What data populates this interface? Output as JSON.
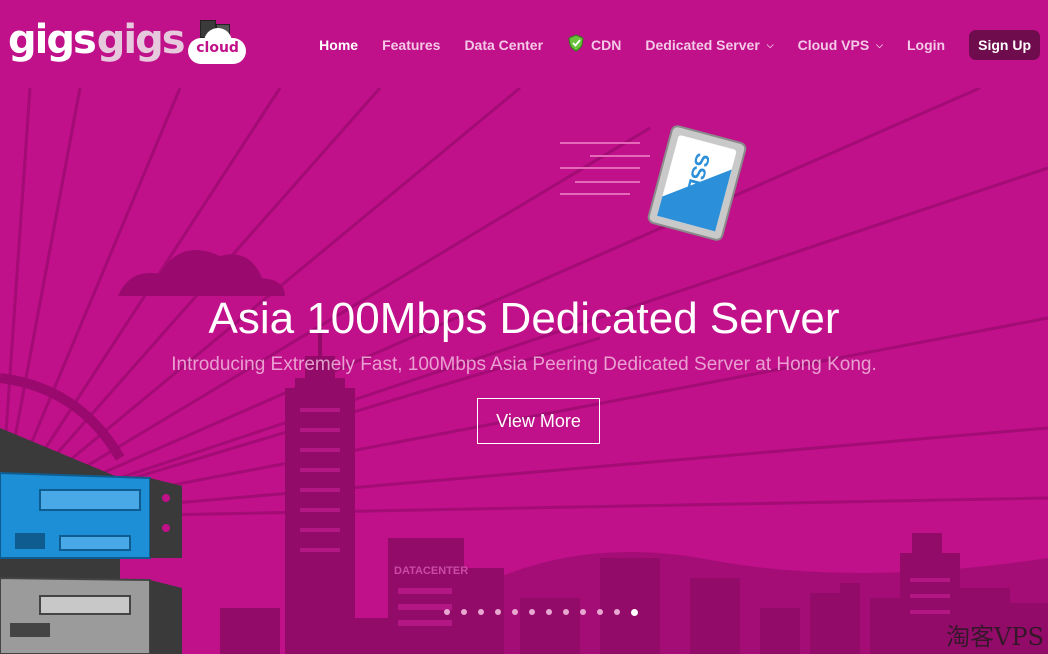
{
  "brand": {
    "logo_text_1": "gigs",
    "logo_text_2": "gigs",
    "logo_badge": "cloud"
  },
  "nav": {
    "items": [
      {
        "label": "Home",
        "active": true
      },
      {
        "label": "Features"
      },
      {
        "label": "Data Center"
      },
      {
        "label": "CDN",
        "icon": "shield-icon"
      },
      {
        "label": "Dedicated Server",
        "dropdown": true
      },
      {
        "label": "Cloud VPS",
        "dropdown": true
      },
      {
        "label": "Login"
      }
    ],
    "signup": "Sign Up"
  },
  "hero": {
    "title": "Asia 100Mbps Dedicated Server",
    "subtitle": "Introducing Extremely Fast, 100Mbps Asia Peering Dedicated Server at Hong Kong.",
    "button": "View More",
    "illustration_labels": {
      "ssd": "SSD",
      "building": "DATACENTER"
    }
  },
  "slider": {
    "total": 12,
    "active_index": 11
  },
  "watermark": "淘客VPS",
  "colors": {
    "background": "#c0108a",
    "nav_text": "#f4c8e6",
    "signup_bg": "#6e0c4d",
    "server_blue": "#1d8fd6"
  }
}
